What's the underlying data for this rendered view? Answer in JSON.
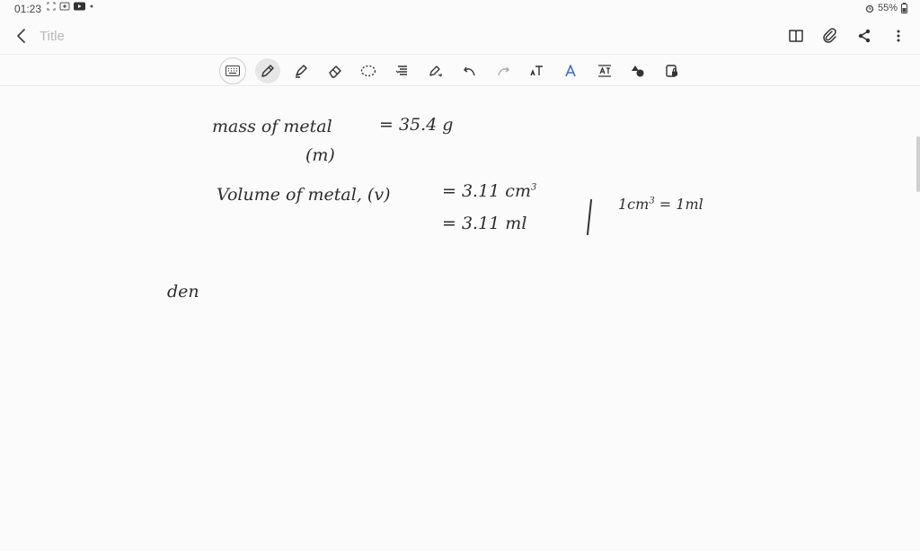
{
  "status": {
    "time": "01:23",
    "battery": "55%"
  },
  "app": {
    "title_placeholder": "Title"
  },
  "toolbar": {
    "tools": [
      "keyboard-icon",
      "pen-icon",
      "highlighter-icon",
      "eraser-icon",
      "lasso-icon",
      "text-align-icon",
      "shape-pen-icon",
      "undo-icon",
      "redo-icon",
      "text-insert-icon",
      "font-icon",
      "text-format-icon",
      "shapes-icon",
      "lock-icon"
    ]
  },
  "note": {
    "line1_label": "mass of  metal",
    "line1_value": "=  35.4 g",
    "line1_sub": "(m)",
    "line2_label": "Volume of metal, (v)",
    "line2_value_num": "=   3.11 cm",
    "line2_value_exp": "3",
    "line3_value": "=  3.11 ml",
    "side_note_num": "1cm",
    "side_note_exp": "3",
    "side_note_rest": " = 1ml",
    "partial": "den"
  }
}
